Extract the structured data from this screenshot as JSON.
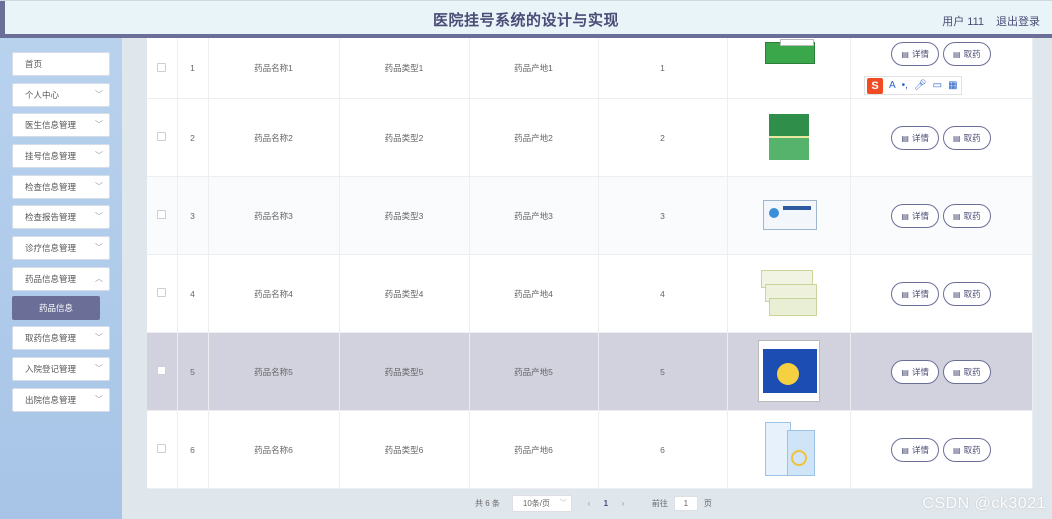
{
  "header": {
    "title": "医院挂号系统的设计与实现",
    "user": "用户 111",
    "logout": "退出登录"
  },
  "sidebar": {
    "items": [
      {
        "label": "首页",
        "chev": false
      },
      {
        "label": "个人中心",
        "chev": true
      },
      {
        "label": "医生信息管理",
        "chev": true
      },
      {
        "label": "挂号信息管理",
        "chev": true
      },
      {
        "label": "检查信息管理",
        "chev": true
      },
      {
        "label": "检查报告管理",
        "chev": true
      },
      {
        "label": "诊疗信息管理",
        "chev": true
      },
      {
        "label": "药品信息管理",
        "chev": true
      }
    ],
    "active_sub": "药品信息",
    "items_after": [
      {
        "label": "取药信息管理",
        "chev": true
      },
      {
        "label": "入院登记管理",
        "chev": true
      },
      {
        "label": "出院信息管理",
        "chev": true
      }
    ]
  },
  "table": {
    "rows": [
      {
        "idx": "1",
        "name": "药品名称1",
        "type": "药品类型1",
        "origin": "药品产地1",
        "num": "1"
      },
      {
        "idx": "2",
        "name": "药品名称2",
        "type": "药品类型2",
        "origin": "药品产地2",
        "num": "2"
      },
      {
        "idx": "3",
        "name": "药品名称3",
        "type": "药品类型3",
        "origin": "药品产地3",
        "num": "3"
      },
      {
        "idx": "4",
        "name": "药品名称4",
        "type": "药品类型4",
        "origin": "药品产地4",
        "num": "4"
      },
      {
        "idx": "5",
        "name": "药品名称5",
        "type": "药品类型5",
        "origin": "药品产地5",
        "num": "5"
      },
      {
        "idx": "6",
        "name": "药品名称6",
        "type": "药品类型6",
        "origin": "药品产地6",
        "num": "6"
      }
    ],
    "btn_detail": "详情",
    "btn_fetch": "取药"
  },
  "pager": {
    "total": "共 6 条",
    "size": "10条/页",
    "current": "1",
    "goto_label": "前往",
    "goto_value": "1",
    "page_unit": "页"
  },
  "ime": {
    "logo": "S",
    "letter": "A"
  },
  "watermark": "CSDN @ck3021"
}
